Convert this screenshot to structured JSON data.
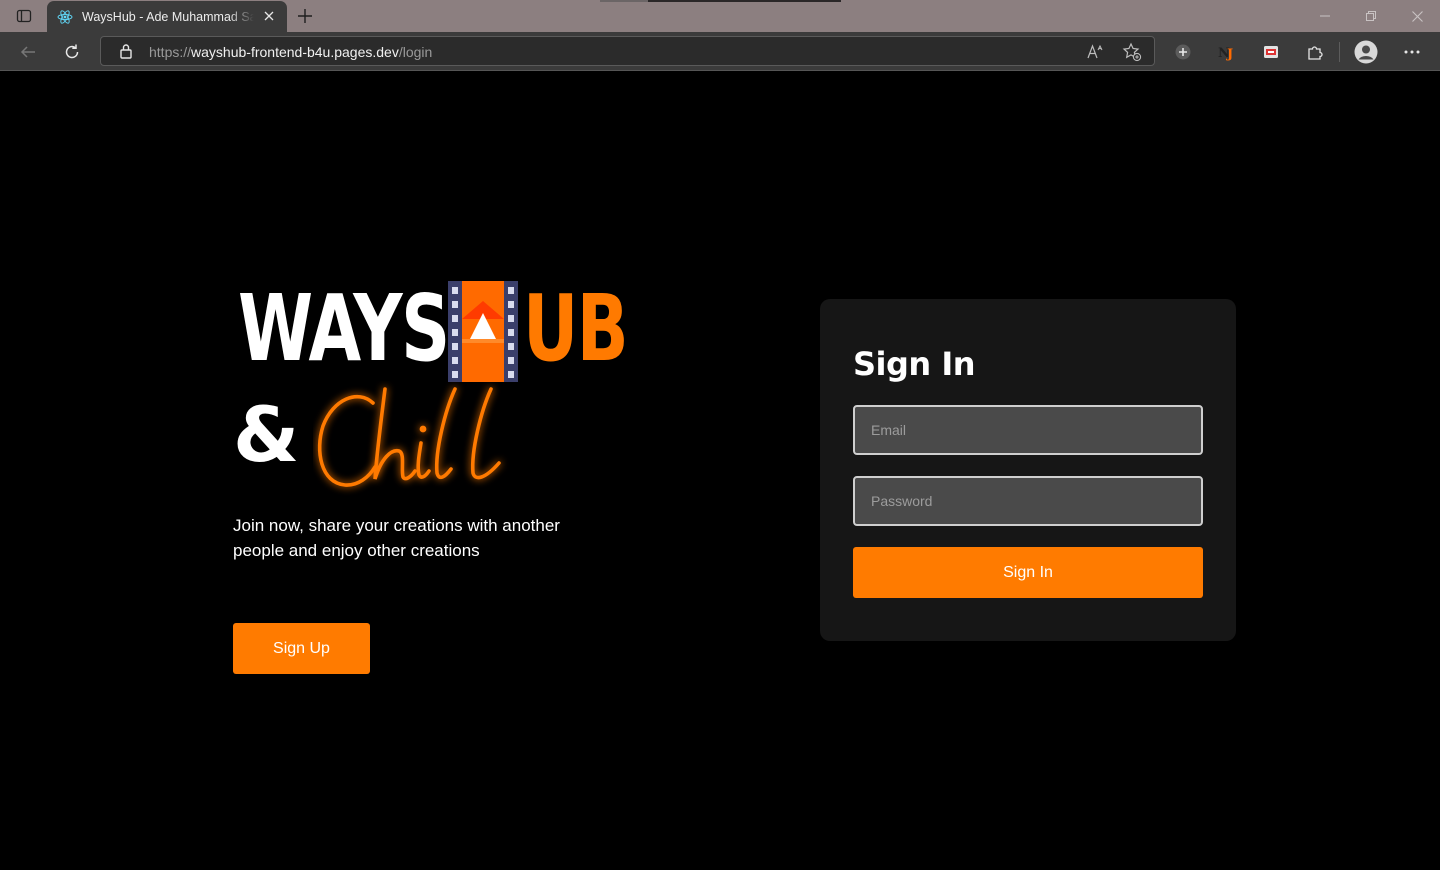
{
  "browser": {
    "tab_title": "WaysHub - Ade Muhammad Safri",
    "url_scheme": "https://",
    "url_host": "wayshub-frontend-b4u.pages.dev",
    "url_path": "/login"
  },
  "logo": {
    "word1": "WAYS",
    "word2": "UB",
    "amp": "&",
    "script_word": "Chill",
    "colors": {
      "white": "#ffffff",
      "orange": "#ff7a00",
      "film_frame": "#3b3f6b"
    }
  },
  "hero": {
    "tagline": "Join now, share your creations with another people and enjoy other creations",
    "signup_label": "Sign Up"
  },
  "signin": {
    "title": "Sign In",
    "email_placeholder": "Email",
    "password_placeholder": "Password",
    "button_label": "Sign In"
  },
  "theme": {
    "accent": "#ff7b00",
    "background": "#000000",
    "card": "#161616"
  }
}
